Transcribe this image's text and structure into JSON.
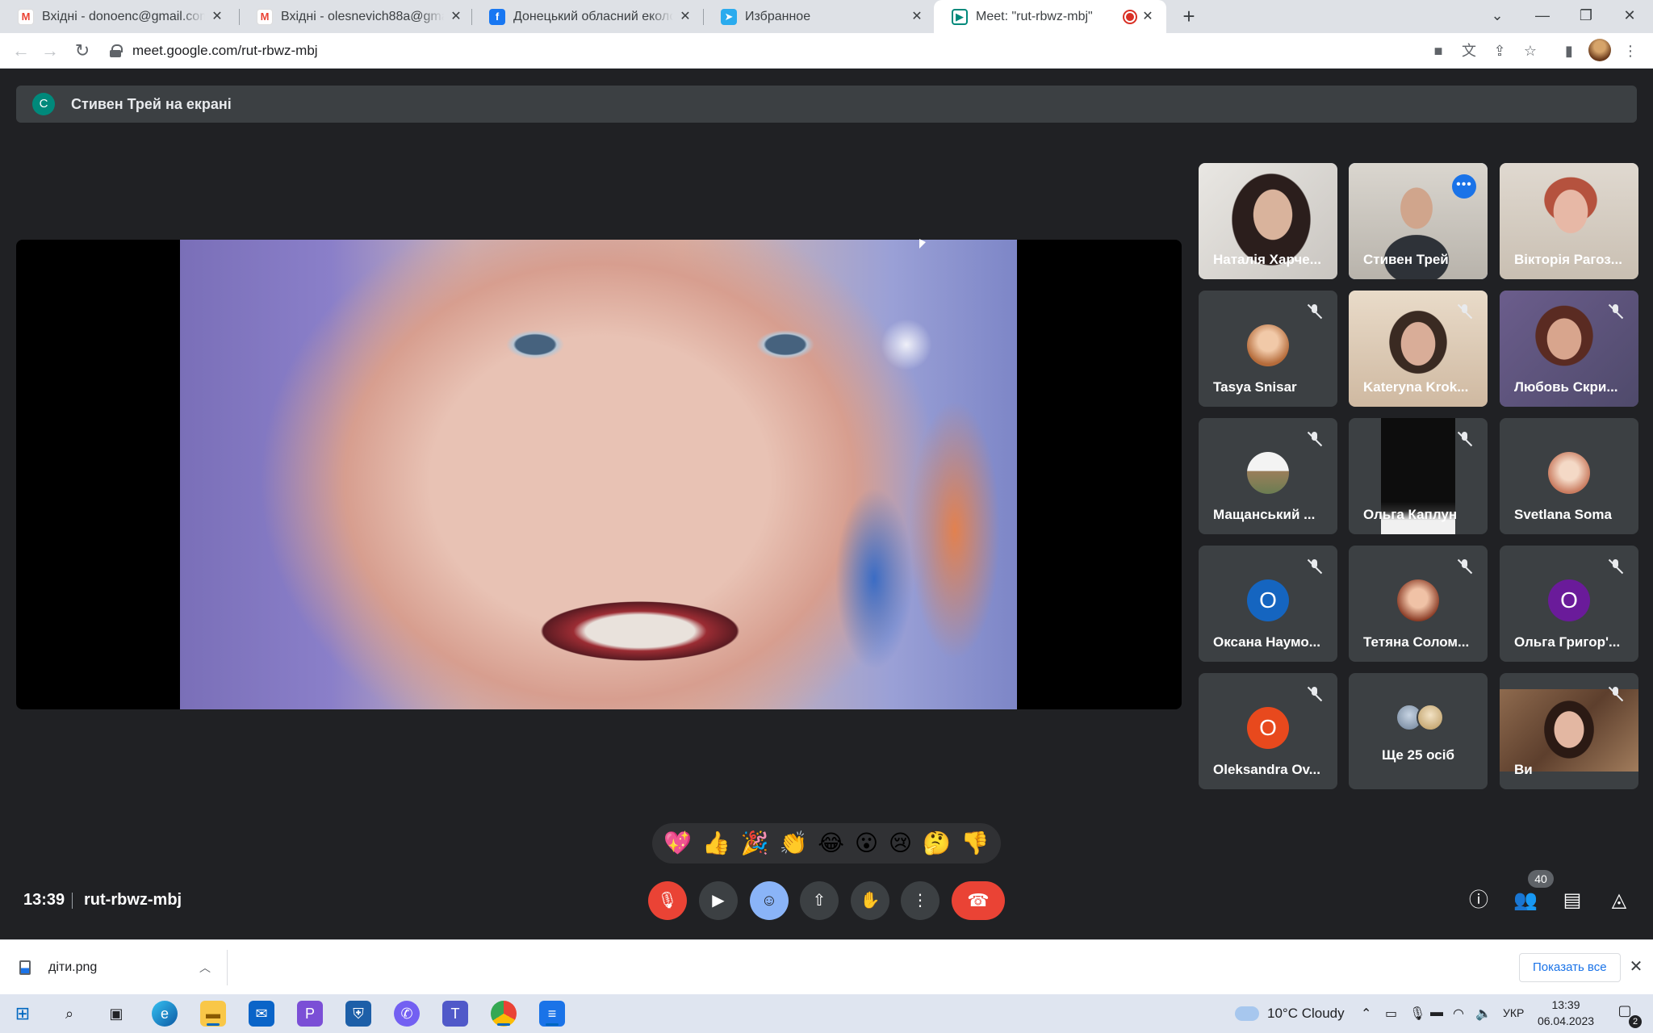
{
  "browser": {
    "tabs": [
      {
        "title": "Вхідні - donoenc@gmail.com - G",
        "icon": "gmail-icon"
      },
      {
        "title": "Вхідні - olesnevich88a@gmail.co",
        "icon": "gmail-icon"
      },
      {
        "title": "Донецький обласний еколого-",
        "icon": "facebook-icon"
      },
      {
        "title": "Избранное",
        "icon": "telegram-icon"
      },
      {
        "title": "Meet: \"rut-rbwz-mbj\"",
        "icon": "google-meet-icon",
        "active": true,
        "recording": true
      }
    ],
    "url": "meet.google.com/rut-rbwz-mbj"
  },
  "meet": {
    "presenting_initial": "C",
    "presenting_text": "Стивен Трей на екрані",
    "participants": [
      {
        "name": "Наталія Харче...",
        "type": "video"
      },
      {
        "name": "Стивен Трей",
        "type": "video",
        "speaking": true
      },
      {
        "name": "Вікторія Рагоз...",
        "type": "video"
      },
      {
        "name": "Tasya Snisar",
        "type": "avatar",
        "muted": true
      },
      {
        "name": "Kateryna Krok...",
        "type": "video",
        "muted": true
      },
      {
        "name": "Любовь Скри...",
        "type": "video",
        "muted": true
      },
      {
        "name": "Мащанський ...",
        "type": "avatar",
        "muted": true
      },
      {
        "name": "Ольга Каплун",
        "type": "video",
        "muted": true
      },
      {
        "name": "Svetlana Soma",
        "type": "avatar"
      },
      {
        "name": "Оксана Наумо...",
        "type": "letter",
        "initial": "О",
        "color": "#1565c0",
        "muted": true
      },
      {
        "name": "Тетяна Солом...",
        "type": "avatar",
        "muted": true
      },
      {
        "name": "Ольга Григор'...",
        "type": "letter",
        "initial": "О",
        "color": "#6a1b9a",
        "muted": true
      },
      {
        "name": "Oleksandra Ov...",
        "type": "letter",
        "initial": "O",
        "color": "#e8491d",
        "muted": true
      },
      {
        "name": "Ще 25 осіб",
        "type": "more"
      },
      {
        "name": "Ви",
        "type": "video",
        "muted": true
      }
    ],
    "reactions": [
      "💖",
      "👍",
      "🎉",
      "👏",
      "😂",
      "😮",
      "😢",
      "🤔",
      "👎"
    ],
    "time": "13:39",
    "meeting_code": "rut-rbwz-mbj",
    "people_count": "40",
    "colors": {
      "accent": "#8ab4f8",
      "hangup": "#ea4335",
      "muted": "#ea4335",
      "tile": "#3c4043"
    }
  },
  "downloads": {
    "file": "діти.png",
    "show_all": "Показать все"
  },
  "taskbar": {
    "weather": "10°C  Cloudy",
    "lang": "УКР",
    "time": "13:39",
    "date": "06.04.2023",
    "notifications": "2"
  }
}
